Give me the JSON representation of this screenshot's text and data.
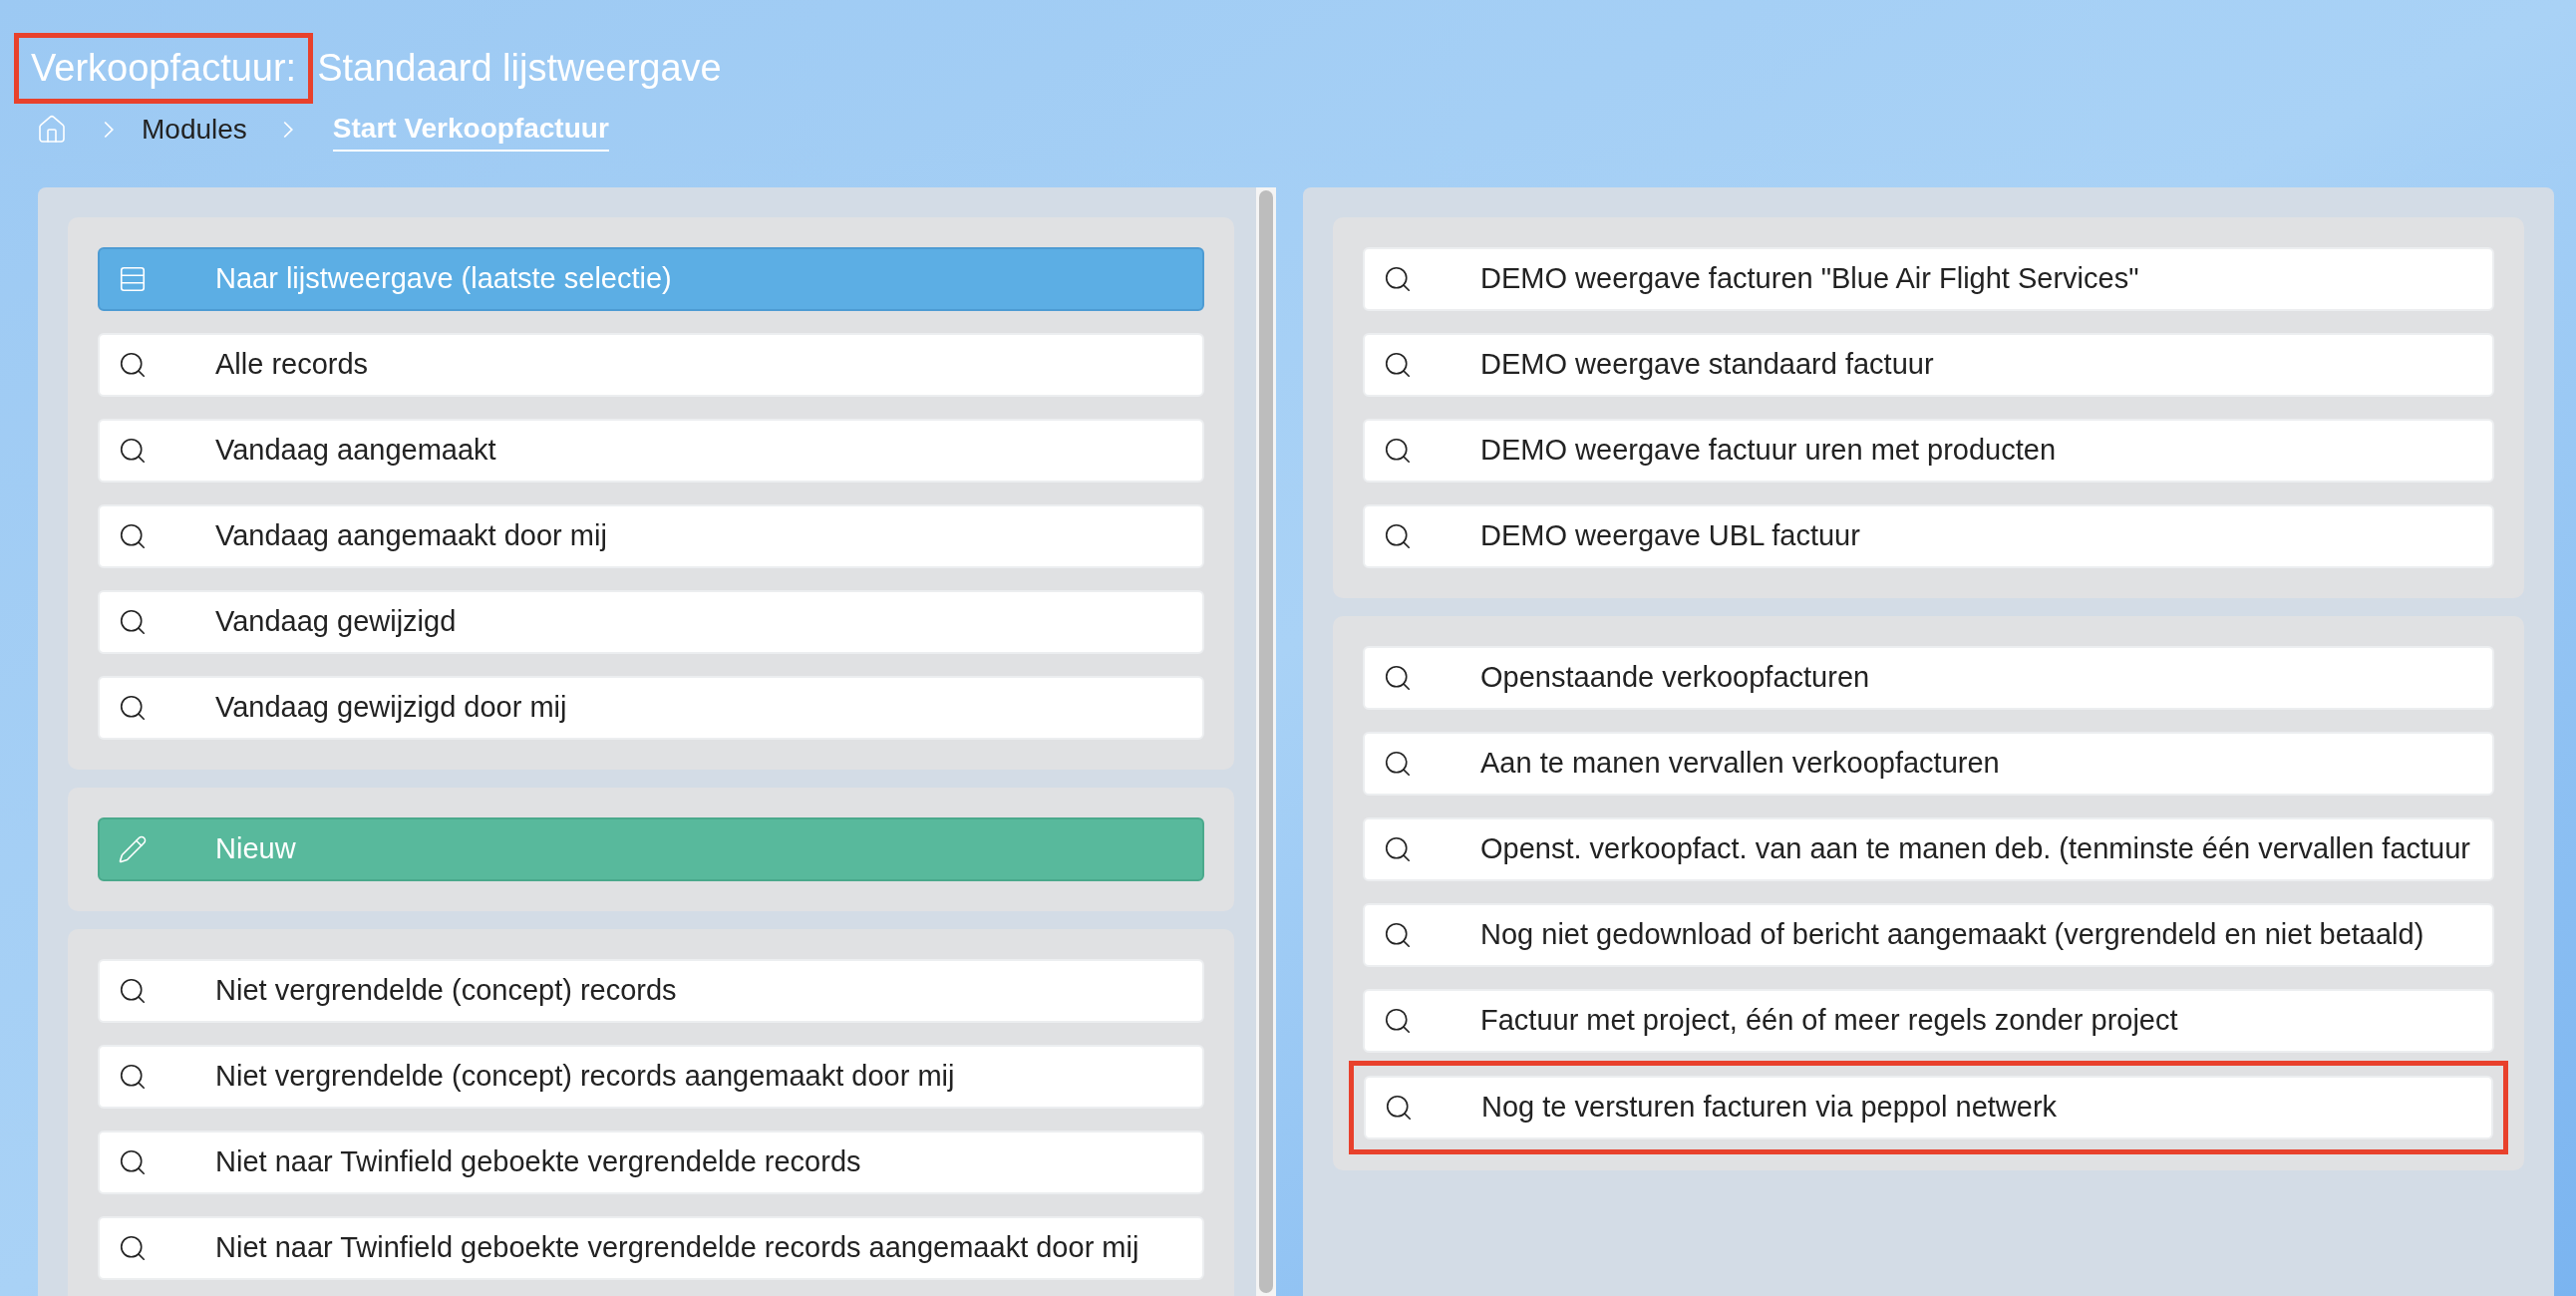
{
  "title": {
    "entity": "Verkoopfactuur:",
    "entity_highlighted": true,
    "view": "Standaard lijstweergave"
  },
  "breadcrumb": [
    {
      "label": "Modules",
      "current": false
    },
    {
      "label": "Start Verkoopfactuur",
      "current": true
    }
  ],
  "left_panel": {
    "groups": [
      {
        "items": [
          {
            "kind": "list",
            "label": "Naar lijstweergave (laatste selectie)",
            "highlighted": false
          },
          {
            "kind": "search",
            "label": "Alle records",
            "highlighted": false
          },
          {
            "kind": "search",
            "label": "Vandaag aangemaakt",
            "highlighted": false
          },
          {
            "kind": "search",
            "label": "Vandaag aangemaakt door mij",
            "highlighted": false
          },
          {
            "kind": "search",
            "label": "Vandaag gewijzigd",
            "highlighted": false
          },
          {
            "kind": "search",
            "label": "Vandaag gewijzigd door mij",
            "highlighted": false
          }
        ]
      },
      {
        "items": [
          {
            "kind": "new",
            "label": "Nieuw",
            "highlighted": false
          }
        ]
      },
      {
        "items": [
          {
            "kind": "search",
            "label": "Niet vergrendelde (concept) records",
            "highlighted": false
          },
          {
            "kind": "search",
            "label": "Niet vergrendelde (concept) records aangemaakt door mij",
            "highlighted": false
          },
          {
            "kind": "search",
            "label": "Niet naar Twinfield geboekte vergrendelde records",
            "highlighted": false
          },
          {
            "kind": "search",
            "label": "Niet naar Twinfield geboekte vergrendelde records aangemaakt door mij",
            "highlighted": false
          }
        ]
      }
    ]
  },
  "right_panel": {
    "groups": [
      {
        "items": [
          {
            "kind": "search",
            "label": "DEMO weergave facturen \"Blue Air Flight Services\"",
            "highlighted": false
          },
          {
            "kind": "search",
            "label": "DEMO weergave standaard factuur",
            "highlighted": false
          },
          {
            "kind": "search",
            "label": "DEMO weergave factuur uren met producten",
            "highlighted": false
          },
          {
            "kind": "search",
            "label": "DEMO weergave UBL factuur",
            "highlighted": false
          }
        ]
      },
      {
        "items": [
          {
            "kind": "search",
            "label": "Openstaande verkoopfacturen",
            "highlighted": false
          },
          {
            "kind": "search",
            "label": "Aan te manen vervallen verkoopfacturen",
            "highlighted": false
          },
          {
            "kind": "search",
            "label": "Openst. verkoopfact. van aan te manen deb. (tenminste één vervallen factuur",
            "highlighted": false
          },
          {
            "kind": "search",
            "label": "Nog niet gedownload of bericht aangemaakt (vergrendeld en niet betaald)",
            "highlighted": false
          },
          {
            "kind": "search",
            "label": "Factuur met project, één of meer regels zonder project",
            "highlighted": false
          },
          {
            "kind": "search",
            "label": "Nog te versturen facturen via peppol netwerk",
            "highlighted": true
          }
        ]
      }
    ]
  }
}
